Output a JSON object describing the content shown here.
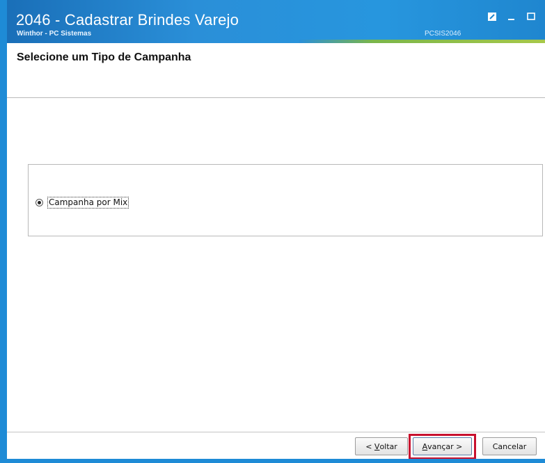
{
  "window": {
    "title": "2046 - Cadastrar Brindes Varejo",
    "subtitle": "Winthor - PC Sistemas",
    "code": "PCSIS2046",
    "colors": {
      "titlebar": "#2a8fd8",
      "accent_stripe": "#a7c84a",
      "highlight": "#c8102e"
    }
  },
  "header": {
    "heading": "Selecione um Tipo de Campanha"
  },
  "campaign_type": {
    "options": [
      {
        "label": "Campanha por Mix",
        "selected": true
      }
    ]
  },
  "footer": {
    "back": {
      "prefix": "< ",
      "mnemonic": "V",
      "rest": "oltar"
    },
    "next": {
      "mnemonic": "A",
      "rest": "vançar",
      "suffix": " >"
    },
    "cancel": "Cancelar"
  }
}
